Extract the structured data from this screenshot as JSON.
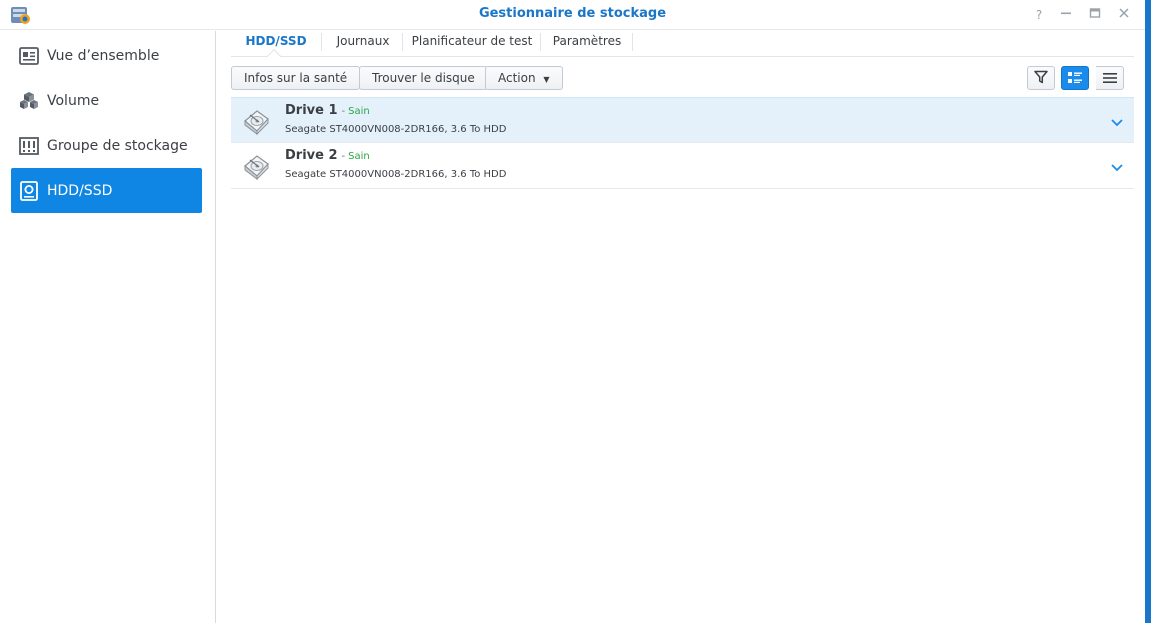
{
  "window": {
    "title": "Gestionnaire de stockage",
    "controls": [
      "help-icon",
      "minimize-icon",
      "maximize-icon",
      "close-icon"
    ]
  },
  "sidebar": {
    "items": [
      {
        "label": "Vue d’ensemble",
        "icon": "overview-icon",
        "active": false
      },
      {
        "label": "Volume",
        "icon": "volume-cubes-icon",
        "active": false
      },
      {
        "label": "Groupe de stockage",
        "icon": "storage-pool-icon",
        "active": false
      },
      {
        "label": "HDD/SSD",
        "icon": "disk-icon",
        "active": true
      }
    ]
  },
  "tabs": [
    {
      "label": "HDD/SSD",
      "active": true
    },
    {
      "label": "Journaux",
      "active": false
    },
    {
      "label": "Planificateur de test",
      "active": false
    },
    {
      "label": "Paramètres",
      "active": false
    }
  ],
  "toolbar": {
    "health_info": "Infos sur la santé",
    "find_disk": "Trouver le disque",
    "action": "Action",
    "view_icons": [
      "filter-icon",
      "detail-view-icon",
      "list-view-icon"
    ]
  },
  "drives": [
    {
      "name": "Drive 1",
      "status": "Sain",
      "description": "Seagate ST4000VN008-2DR166, 3.6 To HDD",
      "selected": true
    },
    {
      "name": "Drive 2",
      "status": "Sain",
      "description": "Seagate ST4000VN008-2DR166, 3.6 To HDD",
      "selected": false
    }
  ],
  "colors": {
    "accent": "#1a76c8",
    "active_nav": "#0f86e3",
    "healthy": "#28a745",
    "selected_row": "#e4f1fb"
  }
}
